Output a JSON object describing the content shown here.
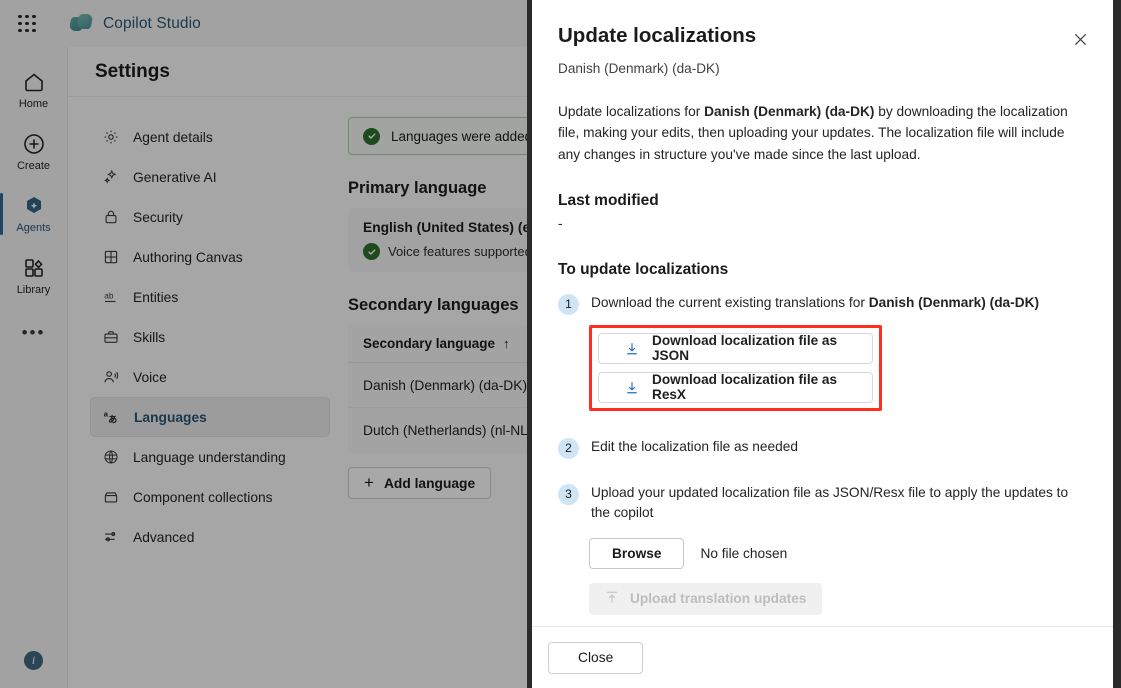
{
  "topbar": {
    "waffle_icon": "grid-waffle-icon",
    "brand": "Copilot Studio"
  },
  "rail": {
    "items": [
      {
        "label": "Home",
        "icon": "home-icon",
        "active": false
      },
      {
        "label": "Create",
        "icon": "plus-circle-icon",
        "active": false
      },
      {
        "label": "Agents",
        "icon": "agent-hexagon-icon",
        "active": true
      },
      {
        "label": "Library",
        "icon": "library-grid-icon",
        "active": false
      }
    ],
    "more_label": "•••",
    "info_label": "i"
  },
  "page": {
    "title": "Settings"
  },
  "settings_nav": {
    "items": [
      {
        "label": "Agent details",
        "icon": "gear-icon",
        "active": false
      },
      {
        "label": "Generative AI",
        "icon": "sparkle-icon",
        "active": false
      },
      {
        "label": "Security",
        "icon": "lock-icon",
        "active": false
      },
      {
        "label": "Authoring Canvas",
        "icon": "canvas-grid-icon",
        "active": false
      },
      {
        "label": "Entities",
        "icon": "ab-icon",
        "active": false
      },
      {
        "label": "Skills",
        "icon": "briefcase-icon",
        "active": false
      },
      {
        "label": "Voice",
        "icon": "voice-person-icon",
        "active": false
      },
      {
        "label": "Languages",
        "icon": "languages-icon",
        "active": true
      },
      {
        "label": "Language understanding",
        "icon": "globe-brain-icon",
        "active": false
      },
      {
        "label": "Component collections",
        "icon": "collection-icon",
        "active": false
      },
      {
        "label": "Advanced",
        "icon": "sliders-icon",
        "active": false
      }
    ]
  },
  "main": {
    "alert": {
      "text": "Languages were added",
      "icon": "check-circle-icon"
    },
    "primary_heading": "Primary language",
    "primary_language": "English (United States) (en-US)",
    "primary_voice_note": "Voice features supported",
    "secondary_heading": "Secondary languages",
    "table": {
      "header": "Secondary language",
      "sort_icon": "arrow-up-icon",
      "rows": [
        "Danish (Denmark) (da-DK)",
        "Dutch (Netherlands) (nl-NL)"
      ]
    },
    "add_language_label": "Add language",
    "add_icon": "plus-icon"
  },
  "panel": {
    "title": "Update localizations",
    "subtitle": "Danish (Denmark) (da-DK)",
    "close_icon": "close-icon",
    "description": {
      "pre": "Update localizations for ",
      "bold": "Danish (Denmark) (da-DK)",
      "post": " by downloading the localization file, making your edits, then uploading your updates. The localization file will include any changes in structure you've made since the last upload."
    },
    "last_modified_heading": "Last modified",
    "last_modified_value": "-",
    "steps_heading": "To update localizations",
    "steps": [
      {
        "num": "1",
        "pre": "Download the current existing translations for ",
        "bold": "Danish (Denmark) (da-DK)",
        "post": ""
      },
      {
        "num": "2",
        "pre": "Edit the localization file as needed",
        "bold": "",
        "post": ""
      },
      {
        "num": "3",
        "pre": "Upload your updated localization file as JSON/Resx file to apply the updates to the copilot",
        "bold": "",
        "post": ""
      }
    ],
    "download_json_label": "Download localization file as JSON",
    "download_resx_label": "Download localization file as ResX",
    "download_icon": "download-arrow-icon",
    "highlight_color": "#ff2d20",
    "browse_label": "Browse",
    "no_file_text": "No file chosen",
    "upload_label": "Upload translation updates",
    "upload_icon": "upload-arrow-icon",
    "close_label": "Close"
  }
}
